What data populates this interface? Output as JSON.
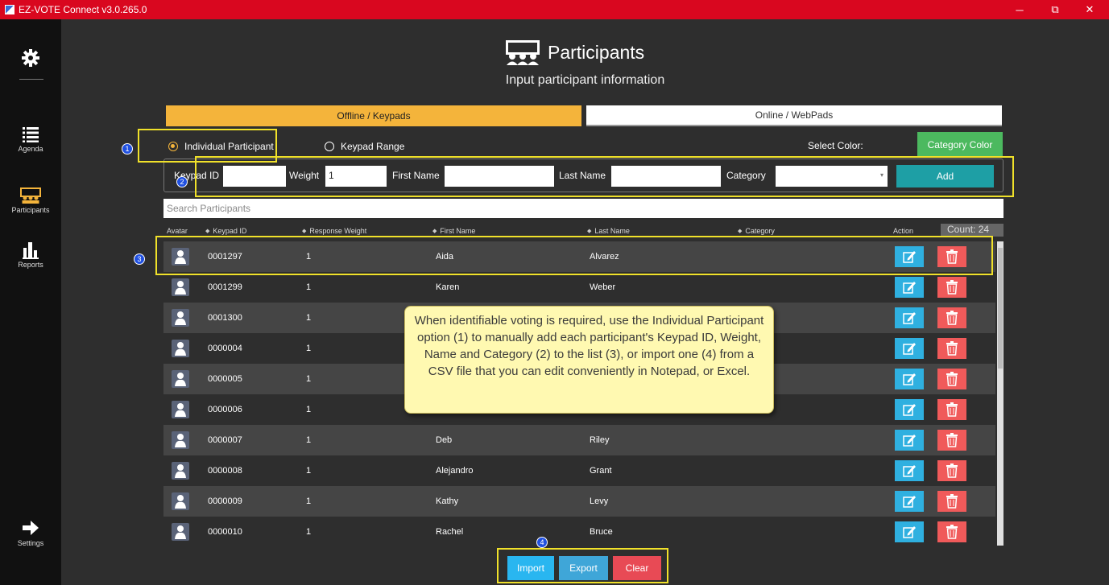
{
  "window": {
    "title": "EZ-VOTE Connect v3.0.265.0",
    "minimize": "─",
    "restore": "⧉",
    "close": "✕"
  },
  "sidebar": {
    "items": [
      {
        "label": "Agenda"
      },
      {
        "label": "Participants"
      },
      {
        "label": "Reports"
      },
      {
        "label": "Settings"
      }
    ]
  },
  "header": {
    "title": "Participants",
    "subtitle": "Input participant information"
  },
  "tabs": [
    {
      "label": "Offline / Keypads"
    },
    {
      "label": "Online / WebPads"
    }
  ],
  "mode": {
    "individual_label": "Individual Participant",
    "range_label": "Keypad Range",
    "select_color_label": "Select Color:",
    "category_color_button": "Category Color"
  },
  "form": {
    "keypad_id_label": "Keypad ID",
    "keypad_id_value": "",
    "weight_label": "Weight",
    "weight_value": "1",
    "first_name_label": "First Name",
    "first_name_value": "",
    "last_name_label": "Last Name",
    "last_name_value": "",
    "category_label": "Category",
    "category_value": "",
    "add_button": "Add"
  },
  "search": {
    "placeholder": "Search Participants"
  },
  "table": {
    "headers": {
      "avatar": "Avatar",
      "keypad_id": "Keypad ID",
      "response_weight": "Response Weight",
      "first_name": "First Name",
      "last_name": "Last Name",
      "category": "Category",
      "action": "Action"
    },
    "count": "Count: 24",
    "rows": [
      {
        "keypad_id": "0001297",
        "weight": "1",
        "first": "Aida",
        "last": "Alvarez"
      },
      {
        "keypad_id": "0001299",
        "weight": "1",
        "first": "Karen",
        "last": "Weber"
      },
      {
        "keypad_id": "0001300",
        "weight": "1",
        "first": "",
        "last": ""
      },
      {
        "keypad_id": "0000004",
        "weight": "1",
        "first": "",
        "last": ""
      },
      {
        "keypad_id": "0000005",
        "weight": "1",
        "first": "",
        "last": ""
      },
      {
        "keypad_id": "0000006",
        "weight": "1",
        "first": "",
        "last": ""
      },
      {
        "keypad_id": "0000007",
        "weight": "1",
        "first": "Deb",
        "last": "Riley"
      },
      {
        "keypad_id": "0000008",
        "weight": "1",
        "first": "Alejandro",
        "last": "Grant"
      },
      {
        "keypad_id": "0000009",
        "weight": "1",
        "first": "Kathy",
        "last": "Levy"
      },
      {
        "keypad_id": "0000010",
        "weight": "1",
        "first": "Rachel",
        "last": "Bruce"
      }
    ]
  },
  "actions": {
    "import": "Import",
    "export": "Export",
    "clear": "Clear"
  },
  "callouts": {
    "n1": "1",
    "n2": "2",
    "n3": "3",
    "n4": "4"
  },
  "tooltip": "When identifiable voting is required, use the Individual Participant option (1) to manually add each participant's Keypad ID, Weight, Name and Category (2) to the list (3), or import one (4) from a CSV file that you can edit conveniently in Notepad, or Excel.",
  "colors": {
    "titlebar": "#d9071f",
    "tab_active": "#f4b43b",
    "add_button": "#1e9fa5",
    "category_color_button": "#4cb95f",
    "edit_button": "#2fb0e0",
    "delete_button": "#f05a5a",
    "import_button": "#29b6f0",
    "export_button": "#3fa6d8",
    "clear_button": "#e84a55",
    "highlight": "#f0e12a"
  }
}
